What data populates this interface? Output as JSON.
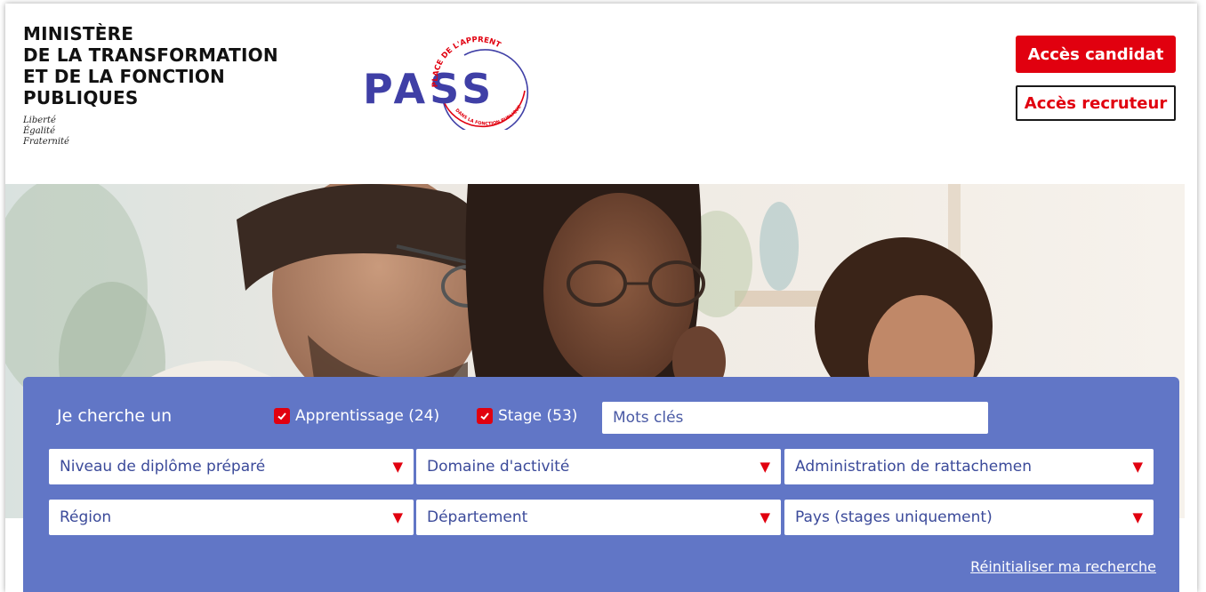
{
  "header": {
    "ministry_lines": [
      "MINISTÈRE",
      "DE LA TRANSFORMATION",
      "ET DE LA FONCTION",
      "PUBLIQUES"
    ],
    "motto_lines": [
      "Liberté",
      "Égalité",
      "Fraternité"
    ],
    "logo": {
      "text": "PASS",
      "arc_text": "PLACE DE L'APPRENTISSAGE ET DES STAGES",
      "arc_bottom_text": "DANS LA FONCTION PUBLIQUE",
      "colors": {
        "text": "#3f3fa6",
        "accent": "#e1000f"
      }
    },
    "buttons": {
      "candidat": "Accès candidat",
      "recruteur": "Accès recruteur"
    }
  },
  "search": {
    "label": "Je cherche un",
    "checkboxes": [
      {
        "label": "Apprentissage (24)",
        "checked": true
      },
      {
        "label": "Stage (53)",
        "checked": true
      }
    ],
    "keywords_placeholder": "Mots clés",
    "selects_row1": [
      "Niveau de diplôme préparé",
      "Domaine d'activité",
      "Administration de rattachemen"
    ],
    "selects_row2": [
      "Région",
      "Département",
      "Pays (stages uniquement)"
    ],
    "reset_link": "Réinitialiser ma recherche"
  },
  "colors": {
    "accent_red": "#e1000f",
    "panel_blue": "#6176c6",
    "text_blue": "#3b4a9a"
  }
}
